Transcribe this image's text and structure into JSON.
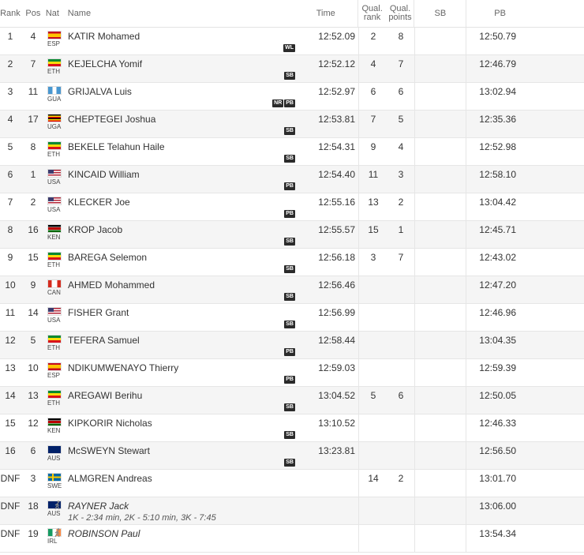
{
  "header": {
    "rank": "Rank",
    "pos": "Pos",
    "nat": "Nat",
    "name": "Name",
    "time": "Time",
    "qual_rank_1": "Qual.",
    "qual_rank_2": "rank",
    "qual_points_1": "Qual.",
    "qual_points_2": "points",
    "sb": "SB",
    "pb": "PB"
  },
  "rows": [
    {
      "rank": "1",
      "pos": "4",
      "nat": "ESP",
      "name": "KATIR Mohamed",
      "time": "12:52.09",
      "qrank": "2",
      "qpoints": "8",
      "sb": "",
      "pb": "12:50.79",
      "badges": [
        "WL"
      ]
    },
    {
      "rank": "2",
      "pos": "7",
      "nat": "ETH",
      "name": "KEJELCHA Yomif",
      "time": "12:52.12",
      "qrank": "4",
      "qpoints": "7",
      "sb": "",
      "pb": "12:46.79",
      "badges": [
        "SB"
      ]
    },
    {
      "rank": "3",
      "pos": "11",
      "nat": "GUA",
      "name": "GRIJALVA Luis",
      "time": "12:52.97",
      "qrank": "6",
      "qpoints": "6",
      "sb": "",
      "pb": "13:02.94",
      "badges": [
        "NR",
        "PB"
      ]
    },
    {
      "rank": "4",
      "pos": "17",
      "nat": "UGA",
      "name": "CHEPTEGEI Joshua",
      "time": "12:53.81",
      "qrank": "7",
      "qpoints": "5",
      "sb": "",
      "pb": "12:35.36",
      "badges": [
        "SB"
      ]
    },
    {
      "rank": "5",
      "pos": "8",
      "nat": "ETH",
      "name": "BEKELE Telahun Haile",
      "time": "12:54.31",
      "qrank": "9",
      "qpoints": "4",
      "sb": "",
      "pb": "12:52.98",
      "badges": [
        "SB"
      ]
    },
    {
      "rank": "6",
      "pos": "1",
      "nat": "USA",
      "name": "KINCAID William",
      "time": "12:54.40",
      "qrank": "11",
      "qpoints": "3",
      "sb": "",
      "pb": "12:58.10",
      "badges": [
        "PB"
      ]
    },
    {
      "rank": "7",
      "pos": "2",
      "nat": "USA",
      "name": "KLECKER Joe",
      "time": "12:55.16",
      "qrank": "13",
      "qpoints": "2",
      "sb": "",
      "pb": "13:04.42",
      "badges": [
        "PB"
      ]
    },
    {
      "rank": "8",
      "pos": "16",
      "nat": "KEN",
      "name": "KROP Jacob",
      "time": "12:55.57",
      "qrank": "15",
      "qpoints": "1",
      "sb": "",
      "pb": "12:45.71",
      "badges": [
        "SB"
      ]
    },
    {
      "rank": "9",
      "pos": "15",
      "nat": "ETH",
      "name": "BAREGA Selemon",
      "time": "12:56.18",
      "qrank": "3",
      "qpoints": "7",
      "sb": "",
      "pb": "12:43.02",
      "badges": [
        "SB"
      ]
    },
    {
      "rank": "10",
      "pos": "9",
      "nat": "CAN",
      "name": "AHMED Mohammed",
      "time": "12:56.46",
      "qrank": "",
      "qpoints": "",
      "sb": "",
      "pb": "12:47.20",
      "badges": [
        "SB"
      ]
    },
    {
      "rank": "11",
      "pos": "14",
      "nat": "USA",
      "name": "FISHER Grant",
      "time": "12:56.99",
      "qrank": "",
      "qpoints": "",
      "sb": "",
      "pb": "12:46.96",
      "badges": [
        "SB"
      ]
    },
    {
      "rank": "12",
      "pos": "5",
      "nat": "ETH",
      "name": "TEFERA Samuel",
      "time": "12:58.44",
      "qrank": "",
      "qpoints": "",
      "sb": "",
      "pb": "13:04.35",
      "badges": [
        "PB"
      ]
    },
    {
      "rank": "13",
      "pos": "10",
      "nat": "ESP",
      "name": "NDIKUMWENAYO Thierry",
      "time": "12:59.03",
      "qrank": "",
      "qpoints": "",
      "sb": "",
      "pb": "12:59.39",
      "badges": [
        "PB"
      ]
    },
    {
      "rank": "14",
      "pos": "13",
      "nat": "ETH",
      "name": "AREGAWI Berihu",
      "time": "13:04.52",
      "qrank": "5",
      "qpoints": "6",
      "sb": "",
      "pb": "12:50.05",
      "badges": [
        "SB"
      ]
    },
    {
      "rank": "15",
      "pos": "12",
      "nat": "KEN",
      "name": "KIPKORIR Nicholas",
      "time": "13:10.52",
      "qrank": "",
      "qpoints": "",
      "sb": "",
      "pb": "12:46.33",
      "badges": [
        "SB"
      ]
    },
    {
      "rank": "16",
      "pos": "6",
      "nat": "AUS",
      "name": "McSWEYN Stewart",
      "time": "13:23.81",
      "qrank": "",
      "qpoints": "",
      "sb": "",
      "pb": "12:56.50",
      "badges": [
        "SB"
      ]
    },
    {
      "rank": "DNF",
      "pos": "3",
      "nat": "SWE",
      "name": "ALMGREN Andreas",
      "time": "",
      "qrank": "14",
      "qpoints": "2",
      "sb": "",
      "pb": "13:01.70",
      "badges": []
    },
    {
      "rank": "DNF",
      "pos": "18",
      "nat": "AUS",
      "name": "RAYNER Jack",
      "time": "",
      "qrank": "",
      "qpoints": "",
      "sb": "",
      "pb": "13:06.00",
      "badges": [],
      "italic": true,
      "walker": true,
      "note": "1K - 2:34 min, 2K - 5:10 min, 3K - 7:45"
    },
    {
      "rank": "DNF",
      "pos": "19",
      "nat": "IRL",
      "name": "ROBINSON Paul",
      "time": "",
      "qrank": "",
      "qpoints": "",
      "sb": "",
      "pb": "13:54.34",
      "badges": [],
      "italic": true,
      "walker": true
    }
  ],
  "flags": {
    "ESP": "#c60b1e",
    "ETH": "#078930",
    "GUA": "#4997d0",
    "UGA": "#000000",
    "USA": "#3c3b6e",
    "KEN": "#006600",
    "CAN": "#d52b1e",
    "AUS": "#012169",
    "SWE": "#006aa7",
    "IRL": "#169b62"
  }
}
